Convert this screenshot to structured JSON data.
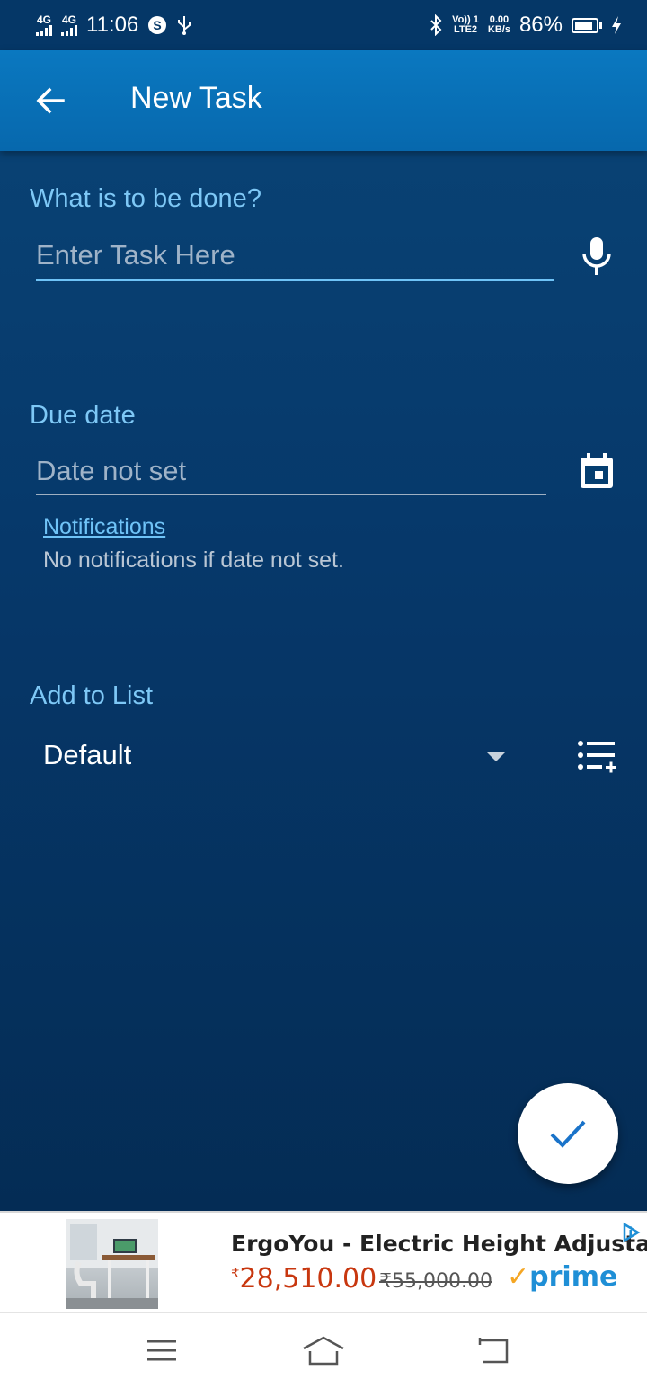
{
  "status_bar": {
    "network1": "4G",
    "network2": "4G",
    "time": "11:06",
    "volte": "Vo)) 1",
    "lte": "LTE2",
    "speed_value": "0.00",
    "speed_unit": "KB/s",
    "battery": "86%",
    "battery_level": 0.86
  },
  "app_bar": {
    "title": "New Task"
  },
  "task": {
    "label": "What is to be done?",
    "placeholder": "Enter Task Here"
  },
  "due_date": {
    "label": "Due date",
    "value": "Date not set",
    "notifications_link": "Notifications",
    "notifications_desc": "No notifications if date not set."
  },
  "list": {
    "label": "Add to List",
    "selected": "Default"
  },
  "ad": {
    "title": "ErgoYou - Electric Height Adjusta...",
    "currency": "₹",
    "price": "28,510.00",
    "old_price": "₹55,000.00",
    "prime": "prime"
  },
  "colors": {
    "accent": "#6fc3f7",
    "appbar": "#0a78c0",
    "background": "#06386a",
    "fab_check": "#1a73c9"
  }
}
